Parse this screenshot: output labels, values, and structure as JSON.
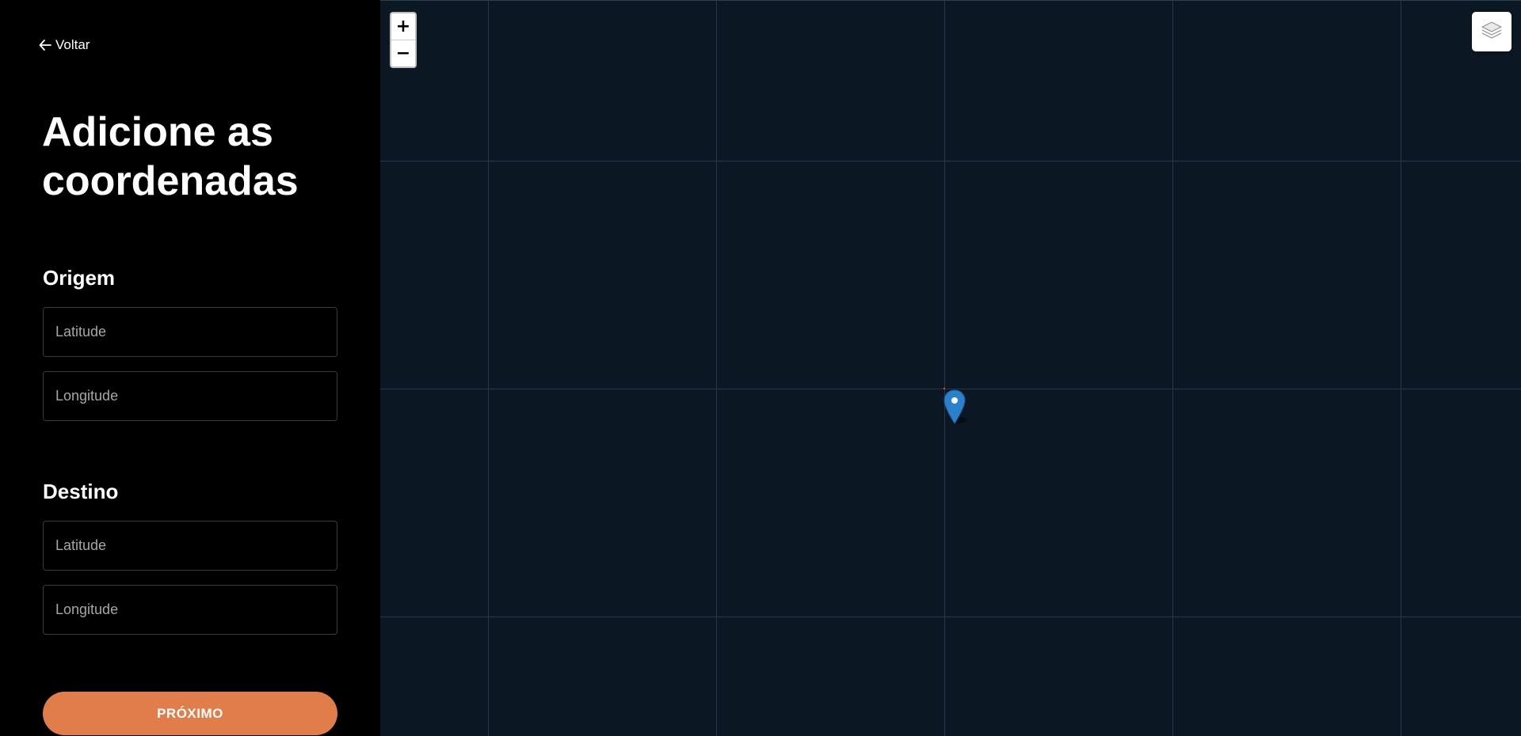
{
  "sidebar": {
    "back_label": "Voltar",
    "title": "Adicione as coordenadas",
    "origin": {
      "heading": "Origem",
      "latitude_placeholder": "Latitude",
      "longitude_placeholder": "Longitude",
      "latitude_value": "",
      "longitude_value": ""
    },
    "destination": {
      "heading": "Destino",
      "latitude_placeholder": "Latitude",
      "longitude_placeholder": "Longitude",
      "latitude_value": "",
      "longitude_value": ""
    },
    "next_label": "PRÓXIMO"
  },
  "map": {
    "zoom_in_label": "+",
    "zoom_out_label": "−",
    "layers_icon": "layers-icon",
    "marker_icon": "map-pin-icon",
    "colors": {
      "background": "#0b1824",
      "grid": "#24384a",
      "marker": "#2a81cb",
      "accent": "#e07d4a"
    }
  }
}
